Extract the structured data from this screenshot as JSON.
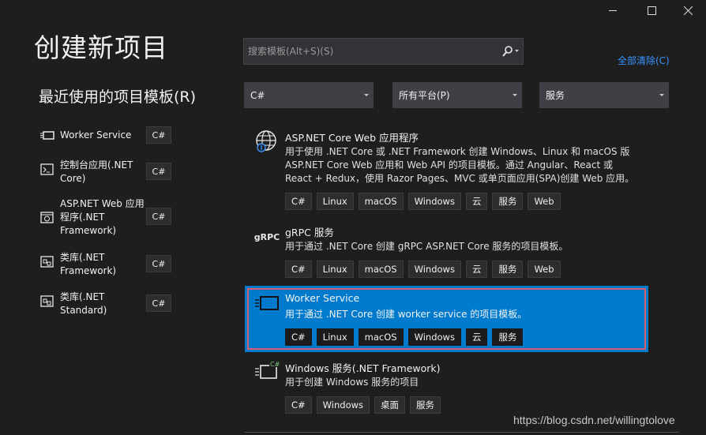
{
  "window": {
    "minimize_icon": "minimize-icon",
    "maximize_icon": "maximize-icon",
    "close_icon": "close-icon"
  },
  "page": {
    "title": "创建新项目",
    "recent_title": "最近使用的项目模板(R)"
  },
  "search": {
    "placeholder": "搜索模板(Alt+S)(S)",
    "clear_all": "全部清除(C)"
  },
  "filters": {
    "language": "C#",
    "platform": "所有平台(P)",
    "project_type": "服务"
  },
  "recent": [
    {
      "name": "Worker Service",
      "lang": "C#",
      "icon": "worker-service-icon"
    },
    {
      "name": "控制台应用(.NET Core)",
      "lang": "C#",
      "icon": "console-app-icon"
    },
    {
      "name": "ASP.NET Web 应用程序(.NET Framework)",
      "lang": "C#",
      "icon": "web-app-icon"
    },
    {
      "name": "类库(.NET Framework)",
      "lang": "C#",
      "icon": "class-library-icon"
    },
    {
      "name": "类库(.NET Standard)",
      "lang": "C#",
      "icon": "class-library-icon"
    }
  ],
  "templates": [
    {
      "name": "ASP.NET Core Web 应用程序",
      "desc": "用于使用 .NET Core 或 .NET Framework 创建 Windows、Linux 和 macOS 版 ASP.NET Core Web 应用和 Web API 的项目模板。通过 Angular、React 或 React + Redux，使用 Razor Pages、MVC 或单页面应用(SPA)创建 Web 应用。",
      "tags": [
        "C#",
        "Linux",
        "macOS",
        "Windows",
        "云",
        "服务",
        "Web"
      ],
      "icon": "globe-icon"
    },
    {
      "name": "gRPC 服务",
      "desc": "用于通过 .NET Core 创建 gRPC ASP.NET Core 服务的项目模板。",
      "tags": [
        "C#",
        "Linux",
        "macOS",
        "Windows",
        "云",
        "服务",
        "Web"
      ],
      "icon_text": "gRPC"
    },
    {
      "name": "Worker Service",
      "desc": "用于通过 .NET Core 创建 worker service 的项目模板。",
      "tags": [
        "C#",
        "Linux",
        "macOS",
        "Windows",
        "云",
        "服务"
      ],
      "icon": "worker-service-icon"
    },
    {
      "name": "Windows 服务(.NET Framework)",
      "desc": "用于创建 Windows 服务的项目",
      "tags": [
        "C#",
        "Windows",
        "桌面",
        "服务"
      ],
      "icon": "windows-service-icon"
    }
  ],
  "watermark": "https://blog.csdn.net/willingtolove",
  "colors": {
    "background": "#1e1e1e",
    "selected": "#007acc",
    "selected_border": "#d45f6d",
    "link": "#3794ff"
  }
}
